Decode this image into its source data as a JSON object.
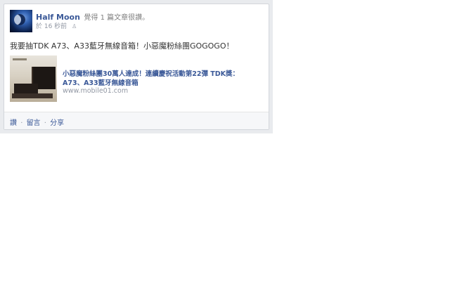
{
  "post": {
    "author": "Half Moon",
    "action": "覺得 1 篇文章很讚。",
    "time": "於 16 秒前",
    "privacy_icon": "people-icon",
    "text": "我要抽TDK A73、A33藍牙無線音箱！小惡魔粉絲團GOGOGO！"
  },
  "shared_link": {
    "title": "小惡魔粉絲團30萬人達成！連續慶祝活動第22彈 TDK獎：A73、A33藍牙無線音箱",
    "domain": "www.mobile01.com"
  },
  "footer": {
    "like": "讚",
    "comment": "留言",
    "share": "分享",
    "separator": "·"
  },
  "colors": {
    "link": "#3b5998",
    "meta": "#9197a3",
    "frame": "#e9ebee"
  }
}
